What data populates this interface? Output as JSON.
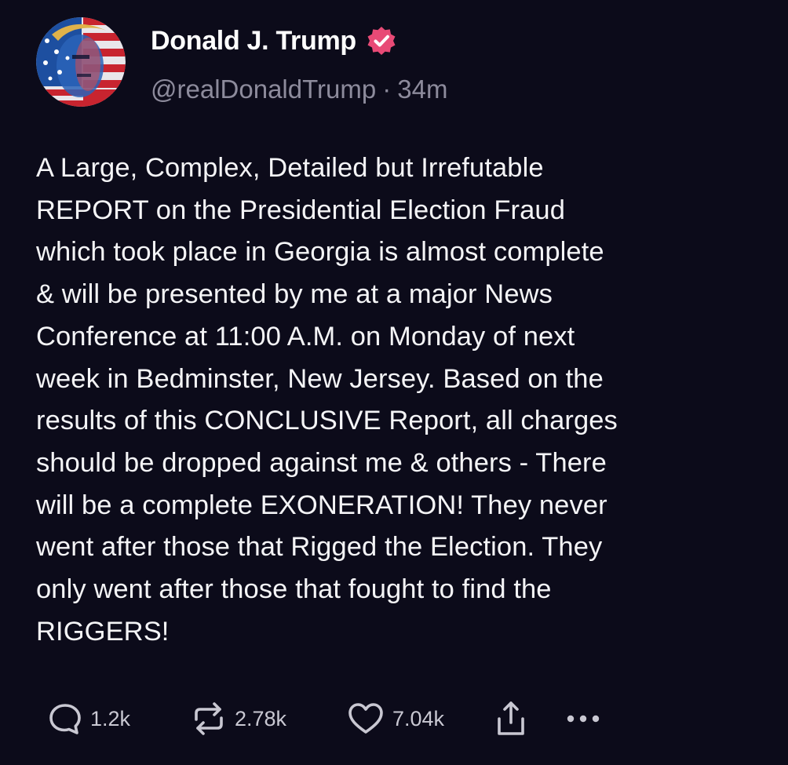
{
  "author": {
    "display_name": "Donald J. Trump",
    "handle": "@realDonaldTrump",
    "separator": "·",
    "time_ago": "34m",
    "verified": true,
    "verified_color": "#e84a76",
    "avatar_icon": "flag-portrait-avatar"
  },
  "post": {
    "text": "A Large, Complex, Detailed but Irrefutable\nREPORT on the Presidential Election Fraud\nwhich took place in Georgia is almost complete\n& will be presented by me at a major News\nConference at 11:00 A.M. on Monday of next\nweek in Bedminster, New Jersey. Based on the\nresults of this CONCLUSIVE Report, all charges\nshould be dropped against me & others - There\nwill be a complete EXONERATION! They never\nwent after those that Rigged the Election. They\nonly went after those that fought to find the\nRIGGERS!"
  },
  "actions": {
    "reply": {
      "icon": "reply-bubble-icon",
      "count": "1.2k"
    },
    "repost": {
      "icon": "repost-arrows-icon",
      "count": "2.78k"
    },
    "like": {
      "icon": "heart-icon",
      "count": "7.04k"
    },
    "share": {
      "icon": "share-upload-icon"
    },
    "more": {
      "icon": "more-dots-icon"
    }
  },
  "colors": {
    "background": "#0c0b1a",
    "text": "#f4f4f6",
    "secondary_text": "#8d8b9c",
    "icon": "#c9c8d2"
  }
}
